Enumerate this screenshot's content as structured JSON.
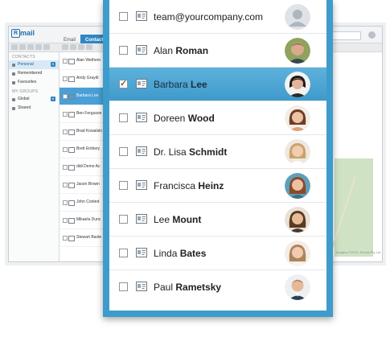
{
  "background_app": {
    "logo_mark": "R",
    "logo_text": "mail",
    "tabs": [
      {
        "label": "Email",
        "active": false
      },
      {
        "label": "Contacts",
        "active": true
      }
    ],
    "sidebar": {
      "contacts_section": "CONTACTS",
      "items": [
        {
          "label": "Personal",
          "count": "9",
          "active": true
        },
        {
          "label": "Remembered",
          "count": "",
          "active": false
        },
        {
          "label": "Favourites",
          "count": "",
          "active": false
        }
      ],
      "groups_section": "MY GROUPS",
      "groups": [
        {
          "label": "Global",
          "count": "8"
        },
        {
          "label": "Shared",
          "count": ""
        }
      ]
    },
    "list": [
      {
        "name": "Alan Wethern",
        "selected": false
      },
      {
        "name": "Andy Graydi",
        "selected": false
      },
      {
        "name": "Barbara Lee",
        "selected": true
      },
      {
        "name": "Ben Ferguson",
        "selected": false
      },
      {
        "name": "Brad Kowalski",
        "selected": false
      },
      {
        "name": "Brett Embery",
        "selected": false
      },
      {
        "name": "didi Demo Ac",
        "selected": false
      },
      {
        "name": "Jason Brown",
        "selected": false
      },
      {
        "name": "John Conted",
        "selected": false
      },
      {
        "name": "Mikaela Dunc",
        "selected": false
      },
      {
        "name": "Stewart Baxte",
        "selected": false
      }
    ],
    "map_credit": "Imagery ©2012, Sensis Pty Ltd"
  },
  "popup": {
    "accent_color": "#3d9ccb",
    "rows": [
      {
        "first": "team@yourcompany.com",
        "last": "",
        "checked": false,
        "selected": false,
        "avatar": "placeholder"
      },
      {
        "first": "Alan",
        "last": "Roman",
        "checked": false,
        "selected": false,
        "avatar": "man-smiling"
      },
      {
        "first": "Barbara",
        "last": "Lee",
        "checked": true,
        "selected": true,
        "avatar": "woman-dark-hair"
      },
      {
        "first": "Doreen",
        "last": "Wood",
        "checked": false,
        "selected": false,
        "avatar": "woman-brunette"
      },
      {
        "first": "Dr. Lisa",
        "last": "Schmidt",
        "checked": false,
        "selected": false,
        "avatar": "woman-blonde"
      },
      {
        "first": "Francisca",
        "last": "Heinz",
        "checked": false,
        "selected": false,
        "avatar": "woman-auburn"
      },
      {
        "first": "Lee",
        "last": "Mount",
        "checked": false,
        "selected": false,
        "avatar": "woman-brown-hair"
      },
      {
        "first": "Linda",
        "last": "Bates",
        "checked": false,
        "selected": false,
        "avatar": "woman-light-brown"
      },
      {
        "first": "Paul",
        "last": "Rametsky",
        "checked": false,
        "selected": false,
        "avatar": "man-suit"
      }
    ]
  }
}
